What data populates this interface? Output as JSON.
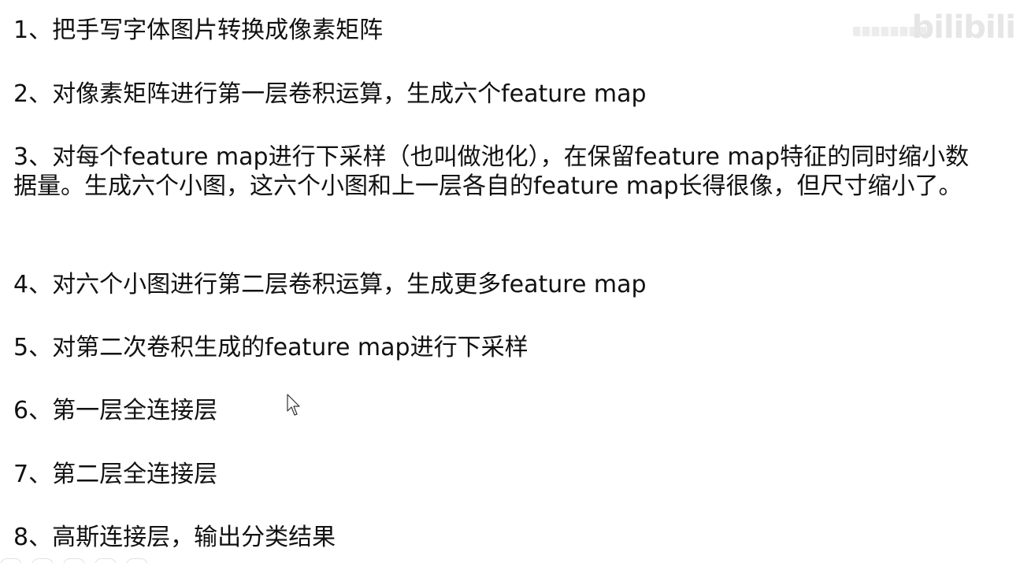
{
  "watermark": "bilibili",
  "steps": [
    "1、把手写字体图片转换成像素矩阵",
    "2、对像素矩阵进行第一层卷积运算，生成六个feature map",
    "3、对每个feature map进行下采样（也叫做池化），在保留feature map特征的同时缩小数据量。生成六个小图，这六个小图和上一层各自的feature map长得很像，但尺寸缩小了。",
    "4、对六个小图进行第二层卷积运算，生成更多feature map",
    "5、对第二次卷积生成的feature map进行下采样",
    "6、第一层全连接层",
    "7、第二层全连接层",
    "8、高斯连接层，输出分类结果"
  ],
  "icons": {
    "cursor": "mouse-pointer-icon"
  }
}
